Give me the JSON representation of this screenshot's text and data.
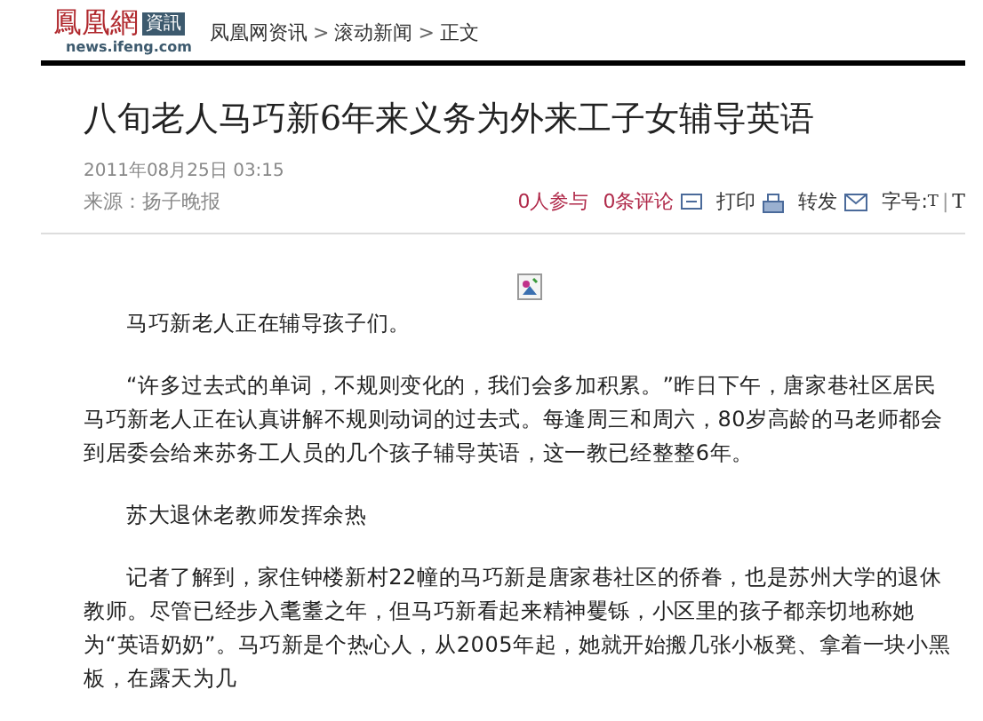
{
  "logo": {
    "name": "鳳凰網",
    "badge": "資訊",
    "domain": "news.ifeng.com"
  },
  "breadcrumb": [
    {
      "label": "凤凰网资讯"
    },
    {
      "label": "滚动新闻"
    },
    {
      "label": "正文"
    }
  ],
  "breadcrumb_separator": ">",
  "title": "八旬老人马巧新6年来义务为外来工子女辅导英语",
  "date": "2011年08月25日  03:15",
  "source": "来源：扬子晚报",
  "actions": [
    {
      "kind": "count",
      "label": "0人参与"
    },
    {
      "kind": "comment",
      "label": "0条评论"
    },
    {
      "kind": "print",
      "label": "打印"
    },
    {
      "kind": "forward",
      "label": "转发"
    }
  ],
  "font_size": {
    "label": "字号:",
    "small": "T",
    "divider": "|",
    "large": "T"
  },
  "image": {
    "kind": "broken"
  },
  "paragraphs": [
    "马巧新老人正在辅导孩子们。",
    "“许多过去式的单词，不规则变化的，我们会多加积累。”昨日下午，唐家巷社区居民马巧新老人正在认真讲解不规则动词的过去式。每逢周三和周六，80岁高龄的马老师都会到居委会给来苏务工人员的几个孩子辅导英语，这一教已经整整6年。",
    "苏大退休老教师发挥余热",
    "记者了解到，家住钟楼新村22幢的马巧新是唐家巷社区的侨眷，也是苏州大学的退休教师。尽管已经步入耄耋之年，但马巧新看起来精神矍铄，小区里的孩子都亲切地称她为“英语奶奶”。马巧新是个热心人，从2005年起，她就开始搬几张小板凳、拿着一块小黑板，在露天为几"
  ]
}
